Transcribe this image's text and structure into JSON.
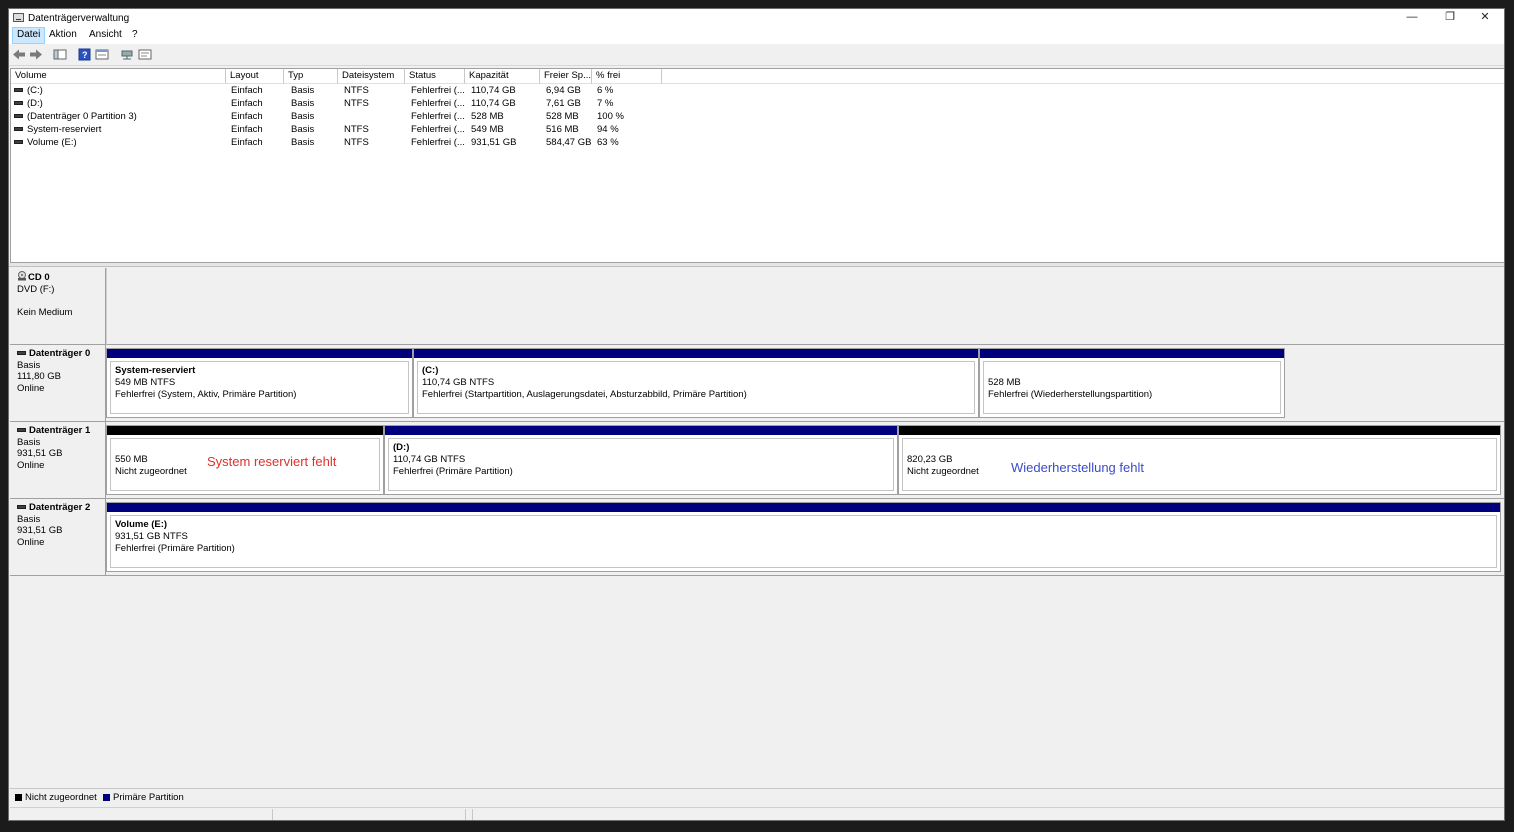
{
  "window": {
    "title": "Datenträgerverwaltung",
    "minimize": "—",
    "restore": "❐",
    "close": "✕"
  },
  "menu": [
    "Datei",
    "Aktion",
    "Ansicht",
    "?"
  ],
  "toolbar": [
    "back-icon",
    "forward-icon",
    "console-tree-icon",
    "help-icon",
    "properties-icon",
    "connect-icon",
    "rescan-icon"
  ],
  "volume_list": {
    "columns": [
      "Volume",
      "Layout",
      "Typ",
      "Dateisystem",
      "Status",
      "Kapazität",
      "Freier Sp...",
      "% frei"
    ],
    "rows": [
      [
        "(C:)",
        "Einfach",
        "Basis",
        "NTFS",
        "Fehlerfrei (...",
        "110,74 GB",
        "6,94 GB",
        "6 %"
      ],
      [
        "(D:)",
        "Einfach",
        "Basis",
        "NTFS",
        "Fehlerfrei (...",
        "110,74 GB",
        "7,61 GB",
        "7 %"
      ],
      [
        "(Datenträger 0 Partition 3)",
        "Einfach",
        "Basis",
        "",
        "Fehlerfrei (...",
        "528 MB",
        "528 MB",
        "100 %"
      ],
      [
        "System-reserviert",
        "Einfach",
        "Basis",
        "NTFS",
        "Fehlerfrei (...",
        "549 MB",
        "516 MB",
        "94 %"
      ],
      [
        "Volume (E:)",
        "Einfach",
        "Basis",
        "NTFS",
        "Fehlerfrei (...",
        "931,51 GB",
        "584,47 GB",
        "63 %"
      ]
    ]
  },
  "disks": {
    "cd0": {
      "name": "CD 0",
      "line1": "DVD (F:)",
      "line2": "",
      "line3": "Kein Medium"
    },
    "disk0": {
      "name": "Datenträger 0",
      "type": "Basis",
      "size": "111,80 GB",
      "state": "Online",
      "partitions": [
        {
          "name": "System-reserviert",
          "size": "549 MB NTFS",
          "status": "Fehlerfrei (System, Aktiv, Primäre Partition)"
        },
        {
          "name": "(C:)",
          "size": "110,74 GB NTFS",
          "status": "Fehlerfrei (Startpartition, Auslagerungsdatei, Absturzabbild, Primäre Partition)"
        },
        {
          "name": "",
          "size": "528 MB",
          "status": "Fehlerfrei (Wiederherstellungspartition)"
        }
      ]
    },
    "disk1": {
      "name": "Datenträger 1",
      "type": "Basis",
      "size": "931,51 GB",
      "state": "Online",
      "partitions": [
        {
          "name": "",
          "size": "550 MB",
          "status": "Nicht zugeordnet"
        },
        {
          "name": "(D:)",
          "size": "110,74 GB NTFS",
          "status": "Fehlerfrei (Primäre Partition)"
        },
        {
          "name": "",
          "size": "820,23 GB",
          "status": "Nicht zugeordnet"
        }
      ],
      "annotations": {
        "left": {
          "text": "System reserviert fehlt",
          "color": "#e0302a"
        },
        "right": {
          "text": "Wiederherstellung fehlt",
          "color": "#3b4bc8"
        }
      }
    },
    "disk2": {
      "name": "Datenträger 2",
      "type": "Basis",
      "size": "931,51 GB",
      "state": "Online",
      "partitions": [
        {
          "name": "Volume  (E:)",
          "size": "931,51 GB NTFS",
          "status": "Fehlerfrei (Primäre Partition)"
        }
      ]
    }
  },
  "legend": [
    {
      "label": "Nicht zugeordnet",
      "color": "#000000"
    },
    {
      "label": "Primäre Partition",
      "color": "#00007f"
    }
  ]
}
